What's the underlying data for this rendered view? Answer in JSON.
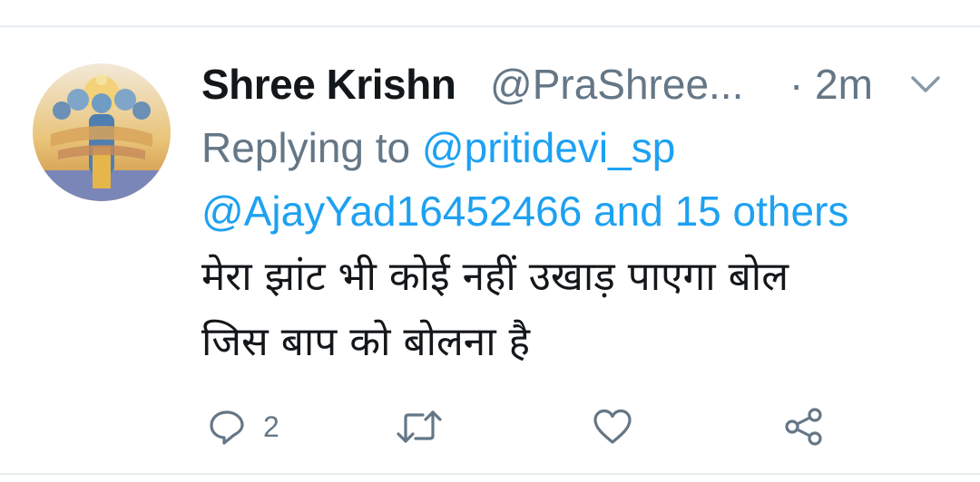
{
  "tweet": {
    "display_name": "Shree Krishn",
    "handle": "@PraShree...",
    "separator": "·",
    "time": "2m",
    "replying_prefix": "Replying to",
    "replying_mention_1": "@pritidevi_sp",
    "replying_mention_2": "@AjayYad16452466",
    "replying_and": "and 15 others",
    "text_line_1": "मेरा झांट भी कोई नहीं उखाड़ पाएगा बोल",
    "text_line_2": "जिस बाप को बोलना है"
  },
  "actions": {
    "reply_count": "2",
    "icons": [
      "reply-icon",
      "retweet-icon",
      "like-icon",
      "share-icon"
    ]
  },
  "colors": {
    "text": "#14171a",
    "secondary": "#657786",
    "link": "#1da1f2",
    "divider": "#e6ecf0"
  }
}
